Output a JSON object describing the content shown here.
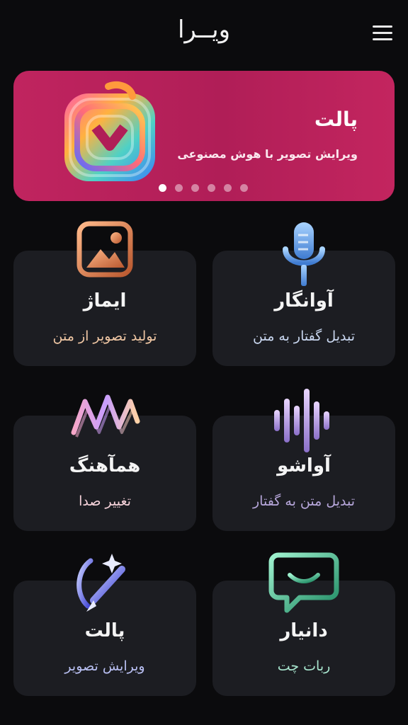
{
  "app": {
    "logo": "ویــرا"
  },
  "banner": {
    "title": "پالت",
    "subtitle": "ویرایش تصویر با هوش مصنوعی",
    "dots_count": 6,
    "active_dot": 1
  },
  "cards": [
    {
      "title": "آوانگار",
      "subtitle": "تبدیل گفتار به متن",
      "icon": "microphone-icon",
      "subtitle_color": "#c9d7f0"
    },
    {
      "title": "ایماژ",
      "subtitle": "تولید تصویر از متن",
      "icon": "image-frame-icon",
      "subtitle_color": "#f0c7a4"
    },
    {
      "title": "آواشو",
      "subtitle": "تبدیل متن به گفتار",
      "icon": "sound-wave-icon",
      "subtitle_color": "#b7a7db"
    },
    {
      "title": "همآهنگ",
      "subtitle": "تغییر صدا",
      "icon": "voice-wave-icon",
      "subtitle_color": "#f5d2da"
    },
    {
      "title": "دانیار",
      "subtitle": "ربات چت",
      "icon": "chat-bubble-icon",
      "subtitle_color": "#a8e6cf"
    },
    {
      "title": "پالت",
      "subtitle": "ویرایش تصویر",
      "icon": "magic-brush-icon",
      "subtitle_color": "#b9c0f3"
    }
  ],
  "colors": {
    "background": "#0b0b0d",
    "card": "#1c1d22",
    "banner": "#b01e57"
  }
}
